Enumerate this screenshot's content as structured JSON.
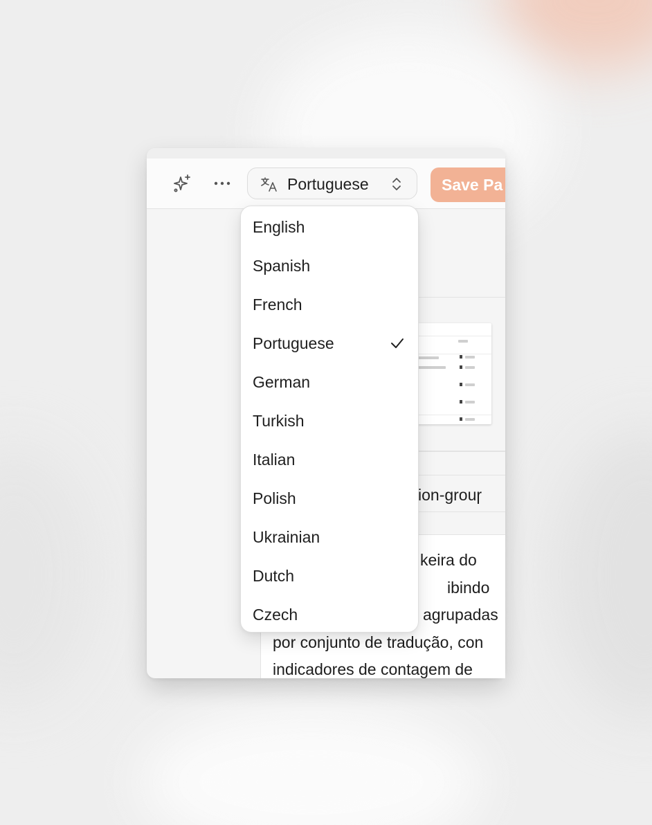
{
  "toolbar": {
    "sparkle_icon": "sparkle-icon",
    "more_icon": "more-horizontal-icon",
    "language_select": {
      "selected": "Portuguese",
      "icon": "translate-icon",
      "chevron_icon": "chevron-up-down-icon"
    },
    "save_label": "Save Pa"
  },
  "dropdown": {
    "options": [
      {
        "label": "English",
        "selected": false
      },
      {
        "label": "Spanish",
        "selected": false
      },
      {
        "label": "French",
        "selected": false
      },
      {
        "label": "Portuguese",
        "selected": true
      },
      {
        "label": "German",
        "selected": false
      },
      {
        "label": "Turkish",
        "selected": false
      },
      {
        "label": "Italian",
        "selected": false
      },
      {
        "label": "Polish",
        "selected": false
      },
      {
        "label": "Ukrainian",
        "selected": false
      },
      {
        "label": "Dutch",
        "selected": false
      },
      {
        "label": "Czech",
        "selected": false
      }
    ],
    "check_icon": "check-icon"
  },
  "content": {
    "code_fragment": "ion-grouɼ",
    "description_lines": [
      "keira do",
      "ibindo",
      "agrupadas",
      "por conjunto de tradução, con",
      "indicadores de contagem de"
    ]
  },
  "colors": {
    "accent": "#f2b295",
    "panel_bg": "#f5f5f5",
    "text": "#1f1f1f"
  }
}
